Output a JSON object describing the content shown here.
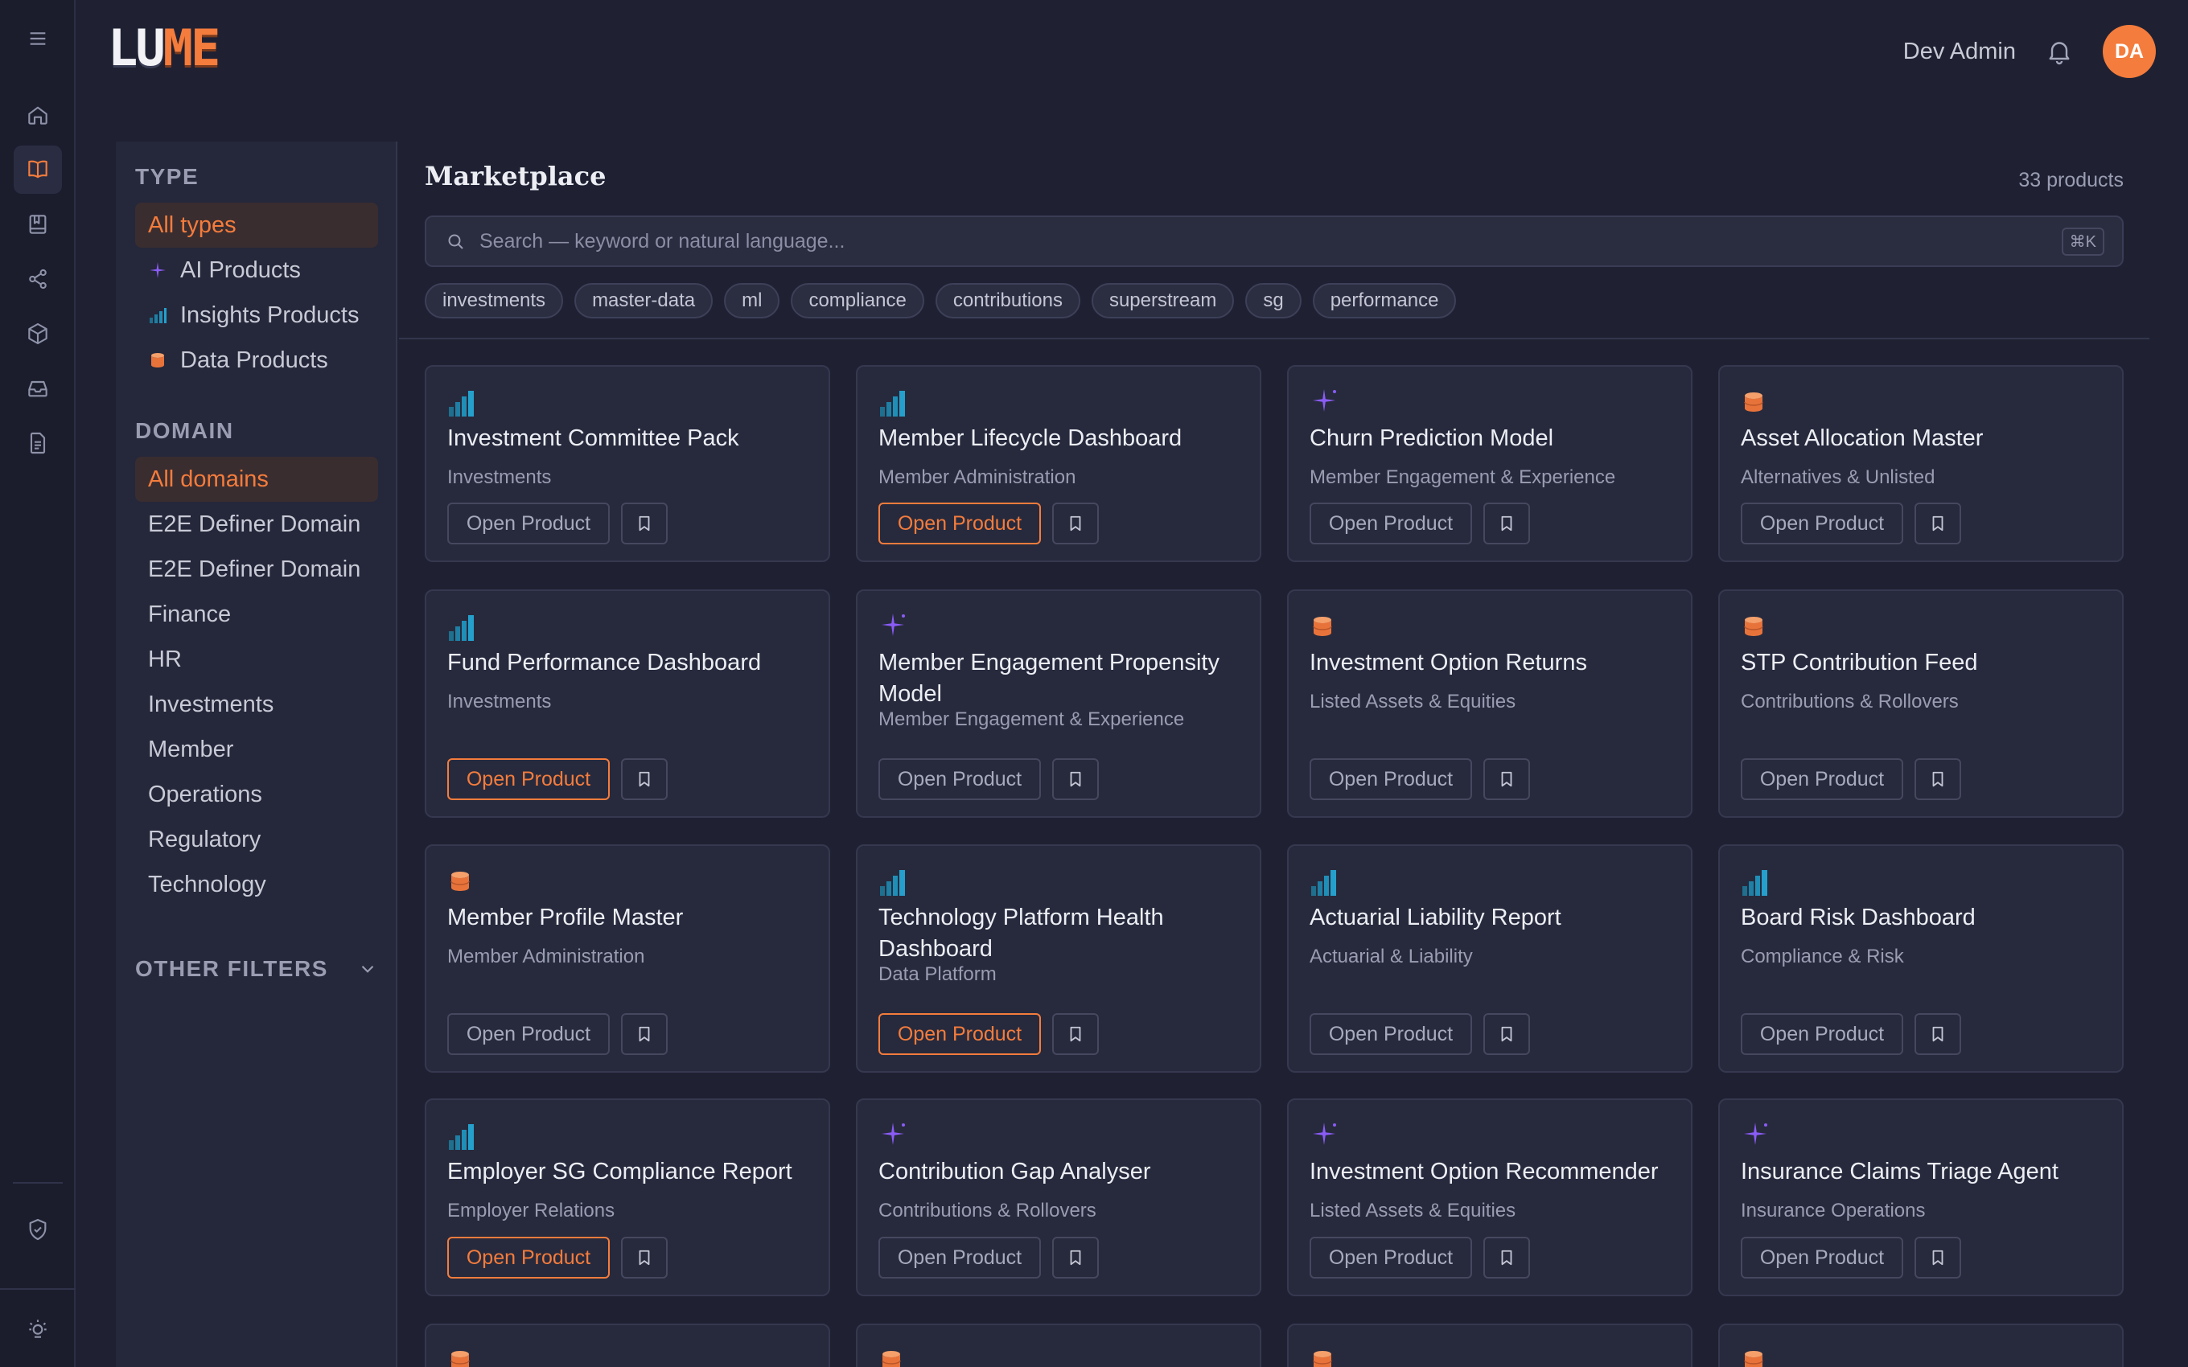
{
  "header": {
    "logo_left": "LU",
    "logo_right": "ME",
    "user_name": "Dev Admin",
    "avatar_initials": "DA"
  },
  "rail": {
    "items": [
      "menu-icon",
      "home-icon",
      "book-open-icon",
      "bookmark-book-icon",
      "share-icon",
      "cube-icon",
      "inbox-icon",
      "document-icon"
    ],
    "bottom": [
      "shield-check-icon",
      "theme-toggle-icon"
    ],
    "active": "book-open-icon"
  },
  "filters": {
    "type_heading": "TYPE",
    "types": [
      {
        "label": "All types",
        "icon": ""
      },
      {
        "label": "AI Products",
        "icon": "sparkle-icon"
      },
      {
        "label": "Insights Products",
        "icon": "bar-chart-icon"
      },
      {
        "label": "Data Products",
        "icon": "database-icon"
      }
    ],
    "domain_heading": "DOMAIN",
    "domains": [
      "All domains",
      "E2E Definer Domain",
      "E2E Definer Domain",
      "Finance",
      "HR",
      "Investments",
      "Member",
      "Operations",
      "Regulatory",
      "Technology"
    ],
    "other_filters": "OTHER FILTERS"
  },
  "main": {
    "title": "Marketplace",
    "count": "33 products",
    "search_placeholder": "Search — keyword or natural language...",
    "search_shortcut": "⌘K",
    "tags": [
      "investments",
      "master-data",
      "ml",
      "compliance",
      "contributions",
      "superstream",
      "sg",
      "performance"
    ]
  },
  "cards": [
    {
      "type": "insights",
      "title": "Investment Committee Pack",
      "domain": "Investments",
      "open_label": "Open Product",
      "highlight": false
    },
    {
      "type": "insights",
      "title": "Member Lifecycle Dashboard",
      "domain": "Member Administration",
      "open_label": "Open Product",
      "highlight": true
    },
    {
      "type": "ai",
      "title": "Churn Prediction Model",
      "domain": "Member Engagement & Experience",
      "open_label": "Open Product",
      "highlight": false
    },
    {
      "type": "data",
      "title": "Asset Allocation Master",
      "domain": "Alternatives & Unlisted",
      "open_label": "Open Product",
      "highlight": false
    },
    {
      "type": "insights",
      "title": "Fund Performance Dashboard",
      "domain": "Investments",
      "open_label": "Open Product",
      "highlight": true
    },
    {
      "type": "ai",
      "title": "Member Engagement Propensity Model",
      "domain": "Member Engagement & Experience",
      "open_label": "Open Product",
      "highlight": false
    },
    {
      "type": "data",
      "title": "Investment Option Returns",
      "domain": "Listed Assets & Equities",
      "open_label": "Open Product",
      "highlight": false
    },
    {
      "type": "data",
      "title": "STP Contribution Feed",
      "domain": "Contributions & Rollovers",
      "open_label": "Open Product",
      "highlight": false
    },
    {
      "type": "data",
      "title": "Member Profile Master",
      "domain": "Member Administration",
      "open_label": "Open Product",
      "highlight": false
    },
    {
      "type": "insights",
      "title": "Technology Platform Health Dashboard",
      "domain": "Data Platform",
      "open_label": "Open Product",
      "highlight": true
    },
    {
      "type": "insights",
      "title": "Actuarial Liability Report",
      "domain": "Actuarial & Liability",
      "open_label": "Open Product",
      "highlight": false
    },
    {
      "type": "insights",
      "title": "Board Risk Dashboard",
      "domain": "Compliance & Risk",
      "open_label": "Open Product",
      "highlight": false
    },
    {
      "type": "insights",
      "title": "Employer SG Compliance Report",
      "domain": "Employer Relations",
      "open_label": "Open Product",
      "highlight": true
    },
    {
      "type": "ai",
      "title": "Contribution Gap Analyser",
      "domain": "Contributions & Rollovers",
      "open_label": "Open Product",
      "highlight": false
    },
    {
      "type": "ai",
      "title": "Investment Option Recommender",
      "domain": "Listed Assets & Equities",
      "open_label": "Open Product",
      "highlight": false
    },
    {
      "type": "ai",
      "title": "Insurance Claims Triage Agent",
      "domain": "Insurance Operations",
      "open_label": "Open Product",
      "highlight": false
    },
    {
      "type": "data",
      "title": "",
      "domain": "",
      "open_label": "",
      "highlight": false
    },
    {
      "type": "data",
      "title": "",
      "domain": "",
      "open_label": "",
      "highlight": false
    },
    {
      "type": "data",
      "title": "",
      "domain": "",
      "open_label": "",
      "highlight": false
    },
    {
      "type": "data",
      "title": "",
      "domain": "",
      "open_label": "",
      "highlight": false
    }
  ],
  "colors": {
    "accent": "#f47c3c",
    "ai": "#8a5cf6",
    "insights": "#1f8fb8",
    "data": "#e8733a",
    "background": "#1f2133"
  }
}
